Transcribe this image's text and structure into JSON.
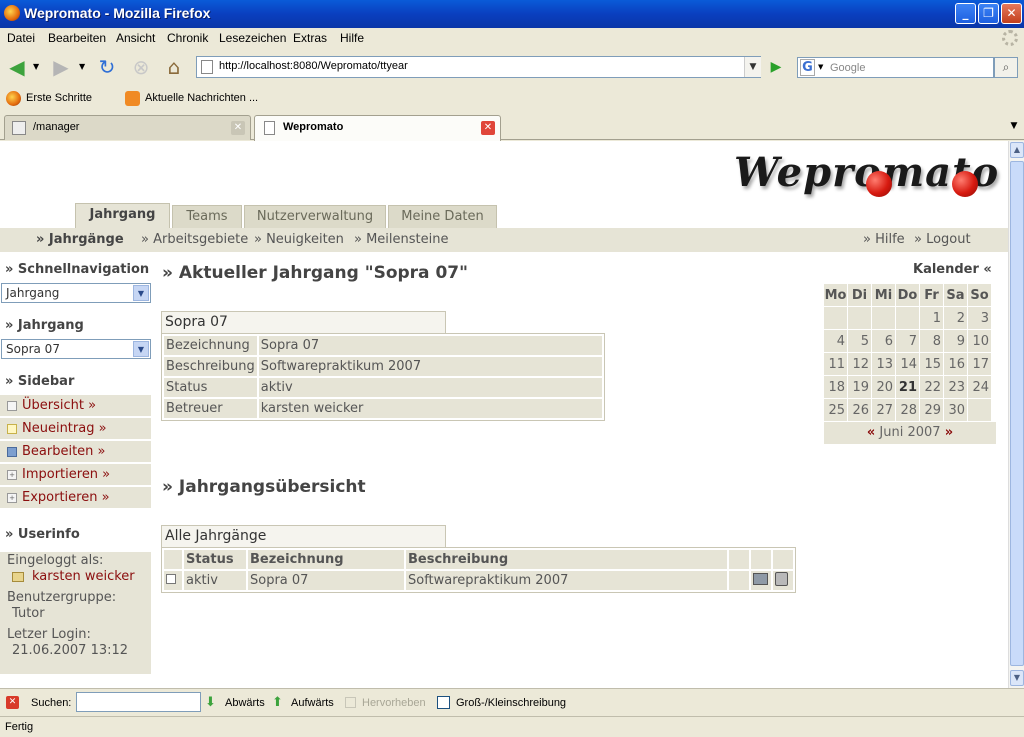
{
  "window": {
    "title": "Wepromato - Mozilla Firefox",
    "min": "_",
    "max": "❐",
    "close": "✕"
  },
  "menu": [
    "Datei",
    "Bearbeiten",
    "Ansicht",
    "Chronik",
    "Lesezeichen",
    "Extras",
    "Hilfe"
  ],
  "toolbar": {
    "url": "http://localhost:8080/Wepromato/ttyear",
    "search_placeholder": "Google",
    "search_engine_icon": "G"
  },
  "bookmarks": [
    {
      "label": "Erste Schritte",
      "icon": "firefox-icon"
    },
    {
      "label": "Aktuelle Nachrichten ...",
      "icon": "rss-icon"
    }
  ],
  "browser_tabs": [
    {
      "label": "/manager",
      "active": false
    },
    {
      "label": "Wepromato",
      "active": true
    }
  ],
  "app": {
    "logo": "Wepromato",
    "tabs": [
      "Jahrgang",
      "Teams",
      "Nutzerverwaltung",
      "Meine Daten"
    ],
    "subnav": [
      "» Jahrgänge",
      "» Arbeitsgebiete",
      "» Neuigkeiten",
      "» Meilensteine"
    ],
    "subnav_right": [
      "» Hilfe",
      "» Logout"
    ]
  },
  "sidebar": {
    "schnellnav_title": "» Schnellnavigation",
    "schnellnav_value": "Jahrgang",
    "jahrgang_title": "» Jahrgang",
    "jahrgang_value": "Sopra 07",
    "sidebar_title": "» Sidebar",
    "items": [
      {
        "label": "Übersicht »",
        "icon": "overview-icon"
      },
      {
        "label": "Neueintrag »",
        "icon": "new-entry-icon"
      },
      {
        "label": "Bearbeiten »",
        "icon": "edit-icon"
      },
      {
        "label": "Importieren »",
        "icon": "import-icon"
      },
      {
        "label": "Exportieren »",
        "icon": "export-icon"
      }
    ],
    "userinfo_title": "» Userinfo",
    "logged_in_label": "Eingeloggt als:",
    "user_name": "karsten weicker",
    "group_label": "Benutzergruppe:",
    "group_value": "Tutor",
    "last_login_label": "Letzer Login:",
    "last_login_value": "21.06.2007 13:12"
  },
  "main": {
    "heading1": "» Aktueller Jahrgang \"Sopra 07\"",
    "box1_title": "Sopra 07",
    "details": [
      {
        "key": "Bezeichnung",
        "value": "Sopra 07"
      },
      {
        "key": "Beschreibung",
        "value": "Softwarepraktikum 2007"
      },
      {
        "key": "Status",
        "value": "aktiv"
      },
      {
        "key": "Betreuer",
        "value": "karsten weicker"
      }
    ],
    "heading2": "» Jahrgangsübersicht",
    "box2_title": "Alle Jahrgänge",
    "table_headers": [
      "Status",
      "Bezeichnung",
      "Beschreibung"
    ],
    "rows": [
      {
        "status": "aktiv",
        "name": "Sopra 07",
        "description": "Softwarepraktikum 2007"
      }
    ]
  },
  "calendar": {
    "title": "Kalender «",
    "days": [
      "Mo",
      "Di",
      "Mi",
      "Do",
      "Fr",
      "Sa",
      "So"
    ],
    "weeks": [
      [
        "",
        "",
        "",
        "",
        "1",
        "2",
        "3"
      ],
      [
        "4",
        "5",
        "6",
        "7",
        "8",
        "9",
        "10"
      ],
      [
        "11",
        "12",
        "13",
        "14",
        "15",
        "16",
        "17"
      ],
      [
        "18",
        "19",
        "20",
        "21",
        "22",
        "23",
        "24"
      ],
      [
        "25",
        "26",
        "27",
        "28",
        "29",
        "30",
        ""
      ]
    ],
    "today": "21",
    "prev": "«",
    "month": "Juni 2007",
    "next": "»"
  },
  "findbar": {
    "search_label": "Suchen:",
    "down": "Abwärts",
    "up": "Aufwärts",
    "highlight": "Hervorheben",
    "case": "Groß-/Kleinschreibung"
  },
  "status": "Fertig",
  "colors": {
    "title_bar": "#0a4ad0",
    "link": "#8b0e0e",
    "panel": "#e6e4d6"
  }
}
